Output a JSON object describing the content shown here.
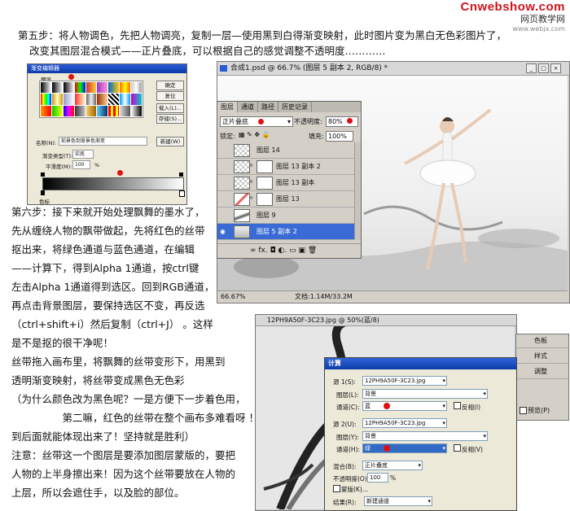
{
  "logo": {
    "site": "Cnwebshow.com",
    "cn": "网页教学网",
    "url": "www.webjx.com"
  },
  "text": {
    "step5_l1": "第五步：将人物调色，先把人物调亮，复制一层—使用黑到白得渐变映射，此时图片变为黑白无色彩图片了，",
    "step5_l2": "改变其图层混合模式——正片叠底，可以根据自己的感觉调整不透明度…………",
    "left_lines": [
      "第六步：接下来就开始处理飘舞的墨水了，",
      "先从缠绕人物的飘带做起，先将红色的丝带",
      "抠出来，将绿色通道与蓝色通道，在编辑",
      "——计算下，得到Alpha 1通道，按ctrl键",
      "左击Alpha 1通道得到选区。回到RGB通道，",
      "再点击背景图层，要保持选区不变，再反选",
      "（ctrl+shift+i）然后复制（ctrl+J） 。这样",
      "是不是抠的很干净呢！",
      "丝带拖入画布里，将飘舞的丝带变形下，用黑到",
      "透明渐变映射，将丝带变成黑色无色彩",
      "（为什么颜色改为黑色呢？一是方便下一步着色用，",
      "　　　　　第二嘛，红色的丝带在整个画布多难看呀 ！",
      "到后面就能体现出来了！坚持就是胜利）",
      "注意：丝带这一个图层是要添加图层蒙版的，要把",
      "人物的上半身擦出来！因为这个丝带要放在人物的",
      "上层，所以会遮住手，以及脸的部位。"
    ]
  },
  "gradient_dialog": {
    "title": "渐变编辑器",
    "preset_label": "预设",
    "buttons": [
      "确定",
      "复位",
      "载入(L)...",
      "存储(S)..."
    ],
    "name_label": "名称(N):",
    "name_value": "前景色到背景色渐变",
    "new_button": "新建(W)",
    "type_label": "渐变类型(T):",
    "type_value": "实底",
    "smooth_label": "平滑度(M):",
    "smooth_value": "100",
    "percent": "%",
    "color_label": "色标"
  },
  "ps_window": {
    "title": "合成1.psd @ 66.7% (图层 5 副本 2, RGB/8) *",
    "zoom": "66.67%",
    "doc_info": "文档:1.14M/33.2M"
  },
  "layers_panel": {
    "tabs": [
      "图层",
      "通道",
      "路径",
      "历史记录"
    ],
    "blend_mode": "正片叠底",
    "opacity_label": "不透明度:",
    "opacity_value": "80%",
    "lock_label": "锁定:",
    "fill_label": "填充:",
    "fill_value": "100%",
    "layers": [
      "图层 14",
      "图层 13 副本 2",
      "图层 13 副本",
      "图层 13",
      "图层 9",
      "图层 5 副本 2"
    ],
    "footer_icons": "∞ fx. ◘ ◐. ▭ ▣ 🗑"
  },
  "calc_window": {
    "title": "12PH9A50F-3C23.jpg @ 50%(蓝/8)"
  },
  "side_panel": {
    "items": [
      "色板",
      "样式",
      "调整"
    ]
  },
  "calc_dialog": {
    "title": "计算",
    "source1_label": "源 1(S):",
    "source1_value": "12PH9A50F-3C23.jpg",
    "layer1_label": "图层(L):",
    "layer1_value": "背景",
    "channel1_label": "通道(C):",
    "channel1_value": "蓝",
    "invert1": "反相(I)",
    "source2_label": "源 2(U):",
    "source2_value": "12PH9A50F-3C23.jpg",
    "layer2_label": "图层(Y):",
    "layer2_value": "背景",
    "channel2_label": "通道(H):",
    "channel2_value": "绿",
    "invert2": "反相(V)",
    "blend_label": "混合(B):",
    "blend_value": "正片叠底",
    "opacity_label": "不透明度(O):",
    "opacity_value": "100",
    "percent": "%",
    "mask_label": "蒙版(K)...",
    "result_label": "结果(R):",
    "result_value": "新建通道",
    "preview": "预览(P)"
  }
}
